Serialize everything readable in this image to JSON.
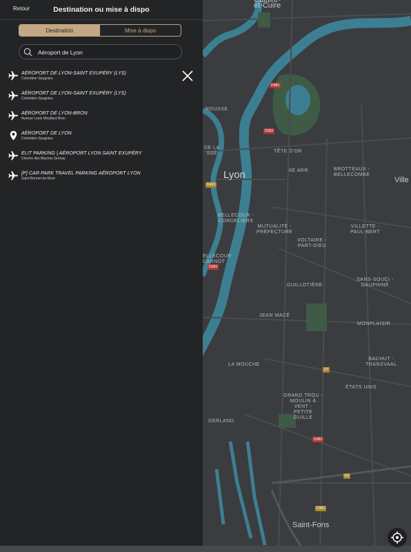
{
  "header": {
    "back_label": "Retour",
    "title": "Destination ou mise à dispo"
  },
  "segmented": {
    "options": [
      "Destination",
      "Mise à dispo"
    ],
    "selected": "Destination",
    "accent": "#c4a783"
  },
  "search": {
    "value": "Aéroport de Lyon"
  },
  "results": [
    {
      "icon": "plane-icon",
      "name": "AÉROPORT DE LYON-SAINT EXUPÉRY (LYS)",
      "sub": "Colombier-Saugnieu"
    },
    {
      "icon": "plane-icon",
      "name": "AÉROPORT DE LYON-SAINT EXUPÉRY (LYS)",
      "sub": "Colombier-Saugnieu"
    },
    {
      "icon": "plane-icon",
      "name": "AÉROPORT DE LYON-BRON",
      "sub": "Avenue Louis Mouillard Bron"
    },
    {
      "icon": "pin-icon",
      "name": "AÉROPORT DE LYON",
      "sub": "Colombier-Saugnieu"
    },
    {
      "icon": "plane-icon",
      "name": "ELIT PARKING | AÉROPORT LYON SAINT EXUPÉRY",
      "sub": "Chemin des Blaches Grenay"
    },
    {
      "icon": "plane-icon",
      "name": "[P] CAR PARK TRAVEL PARKING AÉROPORT LYON",
      "sub": "Saint-Bonnet-de-Mure"
    }
  ],
  "map": {
    "labels": {
      "caluire": "Caluire-\net-Cuire",
      "rousse": "ROUSSE",
      "dela": "DE LA\nSSE",
      "tetedor": "TÊTE D'OR",
      "sixarr": "6E ARR.",
      "brotteaux": "BROTTEAUX -\nBELLECOMBE",
      "lyon": "Lyon",
      "ville": "Ville",
      "bellecour": "BELLECOUR -\nCORDELIERS",
      "mutualite": "MUTUALITÉ -\nPRÉFECTURE",
      "villette": "VILLETTE -\nPAUL-BERT",
      "voltaire": "VOLTAIRE -\nPART-DIEU",
      "ellecour": "ELLECOUR\nCARNOT",
      "guillotiere": "GUILLOTIÈRE",
      "sanssouci": "SANS-SOUCI -\nDAUPHINÉ",
      "jeanmace": "JEAN MACÉ",
      "monplaisir": "MONPLAISIR",
      "lamouche": "LA MOUCHE",
      "bachut": "BACHUT -\nTRANSVAAL",
      "etatsunis": "ÉTATS UNIS",
      "grandtrou": "GRAND TROU -\nMOULIN À\nVENT -\nPETITE\nGUILLE",
      "gerland": "GERLAND",
      "saintfons": "Saint-Fons"
    },
    "badges": [
      "D483",
      "D383",
      "D433",
      "D383",
      "D7",
      "D383",
      "E6",
      "D383"
    ]
  }
}
